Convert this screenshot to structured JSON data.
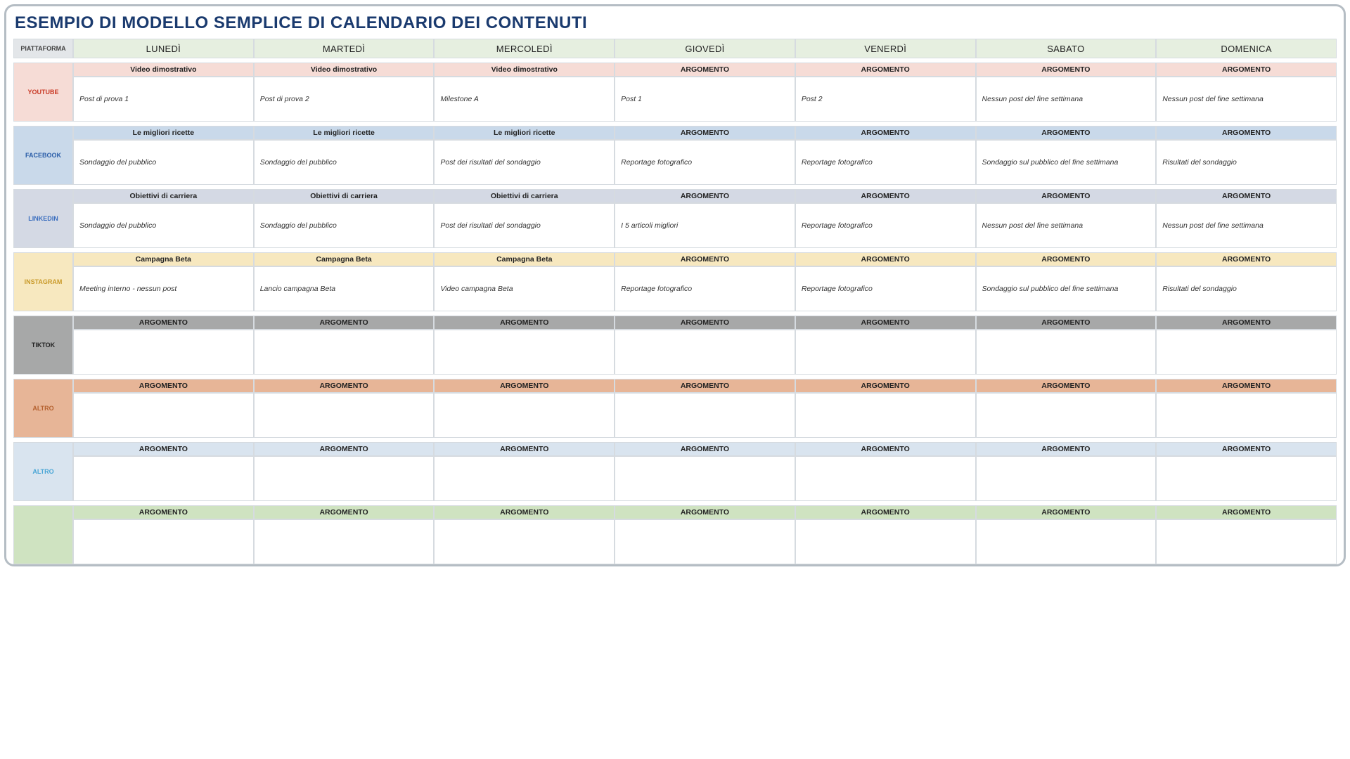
{
  "title": "ESEMPIO DI MODELLO SEMPLICE DI CALENDARIO DEI CONTENUTI",
  "header": {
    "platform": "PIATTAFORMA",
    "days": [
      "LUNEDÌ",
      "MARTEDÌ",
      "MERCOLEDÌ",
      "GIOVEDÌ",
      "VENERDÌ",
      "SABATO",
      "DOMENICA"
    ]
  },
  "platforms": [
    {
      "name": "YOUTUBE",
      "cls": "youtube",
      "topics": [
        "Video dimostrativo",
        "Video dimostrativo",
        "Video dimostrativo",
        "ARGOMENTO",
        "ARGOMENTO",
        "ARGOMENTO",
        "ARGOMENTO"
      ],
      "content": [
        "Post di prova 1",
        "Post di prova 2",
        "Milestone A",
        "Post 1",
        "Post 2",
        "Nessun post del fine settimana",
        "Nessun post del fine settimana"
      ]
    },
    {
      "name": "FACEBOOK",
      "cls": "facebook",
      "topics": [
        "Le migliori ricette",
        "Le migliori ricette",
        "Le migliori ricette",
        "ARGOMENTO",
        "ARGOMENTO",
        "ARGOMENTO",
        "ARGOMENTO"
      ],
      "content": [
        "Sondaggio del pubblico",
        "Sondaggio del pubblico",
        "Post dei risultati del sondaggio",
        "Reportage fotografico",
        "Reportage fotografico",
        "Sondaggio sul pubblico del fine settimana",
        "Risultati del sondaggio"
      ]
    },
    {
      "name": "LINKEDIN",
      "cls": "linkedin",
      "topics": [
        "Obiettivi di carriera",
        "Obiettivi di carriera",
        "Obiettivi di carriera",
        "ARGOMENTO",
        "ARGOMENTO",
        "ARGOMENTO",
        "ARGOMENTO"
      ],
      "content": [
        "Sondaggio del pubblico",
        "Sondaggio del pubblico",
        "Post dei risultati del sondaggio",
        "I 5 articoli migliori",
        "Reportage fotografico",
        "Nessun post del fine settimana",
        "Nessun post del fine settimana"
      ]
    },
    {
      "name": "INSTAGRAM",
      "cls": "instagram",
      "topics": [
        "Campagna Beta",
        "Campagna Beta",
        "Campagna Beta",
        "ARGOMENTO",
        "ARGOMENTO",
        "ARGOMENTO",
        "ARGOMENTO"
      ],
      "content": [
        "Meeting interno - nessun post",
        "Lancio campagna Beta",
        "Video campagna Beta",
        "Reportage fotografico",
        "Reportage fotografico",
        "Sondaggio sul pubblico del fine settimana",
        "Risultati del sondaggio"
      ]
    },
    {
      "name": "TIKTOK",
      "cls": "tiktok",
      "topics": [
        "ARGOMENTO",
        "ARGOMENTO",
        "ARGOMENTO",
        "ARGOMENTO",
        "ARGOMENTO",
        "ARGOMENTO",
        "ARGOMENTO"
      ],
      "content": [
        "",
        "",
        "",
        "",
        "",
        "",
        ""
      ]
    },
    {
      "name": "ALTRO",
      "cls": "altro1",
      "topics": [
        "ARGOMENTO",
        "ARGOMENTO",
        "ARGOMENTO",
        "ARGOMENTO",
        "ARGOMENTO",
        "ARGOMENTO",
        "ARGOMENTO"
      ],
      "content": [
        "",
        "",
        "",
        "",
        "",
        "",
        ""
      ]
    },
    {
      "name": "ALTRO",
      "cls": "altro2",
      "topics": [
        "ARGOMENTO",
        "ARGOMENTO",
        "ARGOMENTO",
        "ARGOMENTO",
        "ARGOMENTO",
        "ARGOMENTO",
        "ARGOMENTO"
      ],
      "content": [
        "",
        "",
        "",
        "",
        "",
        "",
        ""
      ]
    },
    {
      "name": "",
      "cls": "altro3",
      "topics": [
        "ARGOMENTO",
        "ARGOMENTO",
        "ARGOMENTO",
        "ARGOMENTO",
        "ARGOMENTO",
        "ARGOMENTO",
        "ARGOMENTO"
      ],
      "content": [
        "",
        "",
        "",
        "",
        "",
        "",
        ""
      ]
    }
  ]
}
